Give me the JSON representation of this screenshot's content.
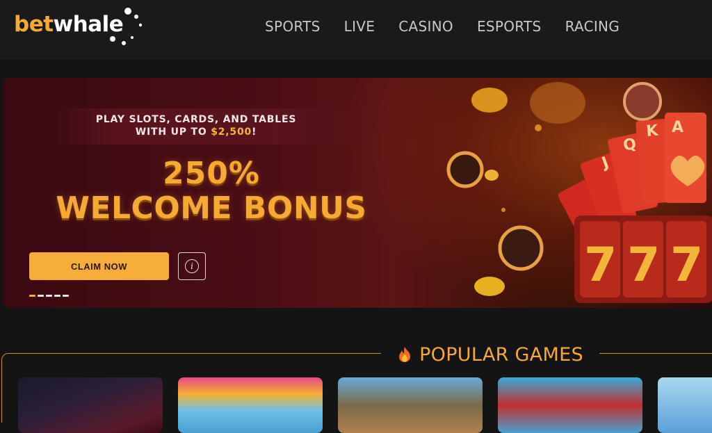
{
  "brand": {
    "logo_part1": "bet",
    "logo_part2": "whale",
    "accent_color": "#f6a934"
  },
  "nav": {
    "items": [
      {
        "label": "SPORTS"
      },
      {
        "label": "LIVE"
      },
      {
        "label": "CASINO"
      },
      {
        "label": "ESPORTS"
      },
      {
        "label": "RACING"
      }
    ]
  },
  "banner": {
    "promo_line1": "PLAY SLOTS, CARDS, AND TABLES",
    "promo_line2_prefix": "WITH UP TO ",
    "promo_amount": "$2,500",
    "promo_line2_suffix": "!",
    "bonus_percent": "250%",
    "bonus_title": "WELCOME BONUS",
    "claim_label": "CLAIM NOW",
    "info_icon_glyph": "i",
    "slide_count": 5,
    "active_slide": 1
  },
  "popular_games": {
    "title": "POPULAR GAMES",
    "icon": "fire-icon"
  }
}
